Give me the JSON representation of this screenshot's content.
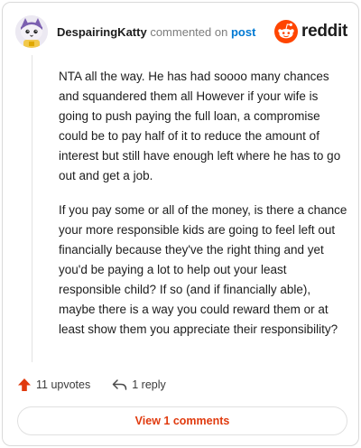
{
  "header": {
    "username": "DespairingKatty",
    "verb": "commented on",
    "link_text": "post",
    "brand_name": "reddit",
    "brand_color": "#ff4500"
  },
  "comment": {
    "paragraphs": [
      "NTA all the way. He has had soooo many chances and squandered them all However if your wife is going to push paying the full loan, a compromise could be to pay half of it to reduce the amount of interest but still have enough left where he has to go out and get a job.",
      "If you pay some or all of the money, is there a chance your more responsible kids are going to feel left out financially because they've the right thing and yet you'd be paying a lot to help out your least responsible child? If so (and if financially able), maybe there is a way you could reward them or at least show them you appreciate their responsibility?"
    ]
  },
  "actions": {
    "upvotes_label": "11 upvotes",
    "upvote_icon": "upvote-arrow-icon",
    "reply_label": "1 reply",
    "reply_icon": "reply-icon"
  },
  "footer": {
    "view_comments_label": "View 1 comments",
    "accent_color": "#e03a0e"
  }
}
